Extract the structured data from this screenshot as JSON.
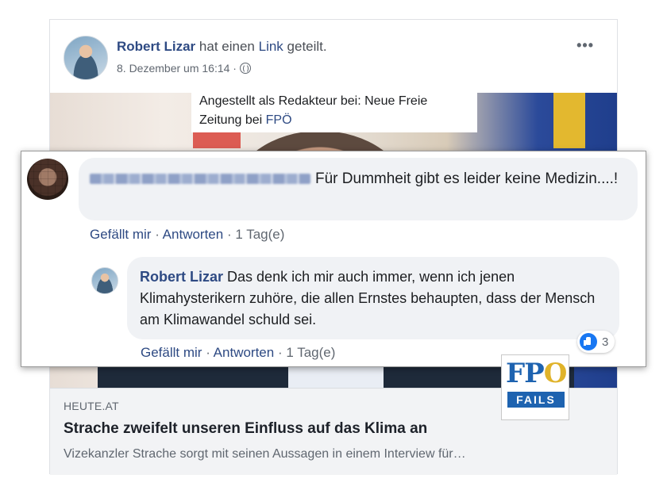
{
  "post": {
    "author": "Robert Lizar",
    "action_prefix": "hat einen",
    "action_link": "Link",
    "action_suffix": "geteilt.",
    "timestamp": "8. Dezember um 16:14 ·",
    "privacy_icon": "globe-icon",
    "more_icon": "more-options-icon",
    "more_label": "•••",
    "caption_text": "Angestellt als Redakteur bei: Neue Freie Zeitung bei",
    "caption_link": "FPÖ"
  },
  "link_preview": {
    "domain": "HEUTE.AT",
    "title": "Strache zweifelt unseren Einfluss auf das Klima an",
    "description": "Vizekanzler Strache sorgt mit seinen Aussagen in einem Interview für…"
  },
  "comments": [
    {
      "author_blurred": true,
      "text": "Für Dummheit gibt es leider keine Medizin....!",
      "like_label": "Gefällt mir",
      "reply_label": "Antworten",
      "time": "1 Tag(e)"
    }
  ],
  "reply": {
    "author": "Robert Lizar",
    "text": "Das denk ich mir auch immer, wenn ich jenen Klimahysterikern zuhöre, die allen Ernstes behaupten, dass der Mensch am Klimawandel schuld sei.",
    "like_label": "Gefällt mir",
    "reply_label": "Antworten",
    "time": "1 Tag(e)",
    "reaction_icon": "thumbs-up-icon",
    "reaction_count": "3"
  },
  "logo": {
    "top_text_a": "FP",
    "top_text_o": "O",
    "bar_text": "FAILS"
  },
  "colors": {
    "link_blue": "#2e4a83",
    "secondary_text": "#606770",
    "bubble_bg": "#f0f2f5",
    "like_blue": "#1877f2",
    "logo_blue": "#1e63b0",
    "logo_gold": "#e0b32a"
  }
}
